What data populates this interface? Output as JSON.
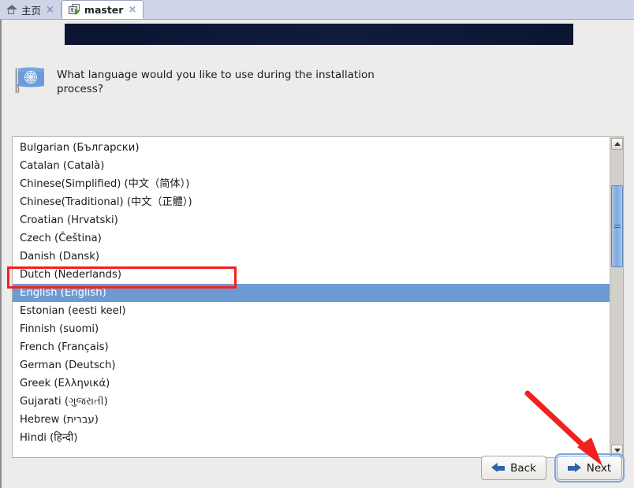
{
  "tabs": [
    {
      "label": "主页",
      "icon": "home-icon",
      "close": "×",
      "active": false
    },
    {
      "label": "master",
      "icon": "virtual-machine-icon",
      "close": "×",
      "active": true
    }
  ],
  "installer": {
    "icon": "un-flag-icon",
    "question": "What language would you like to use during the installation process?",
    "languages": [
      "Bulgarian (Български)",
      "Catalan (Català)",
      "Chinese(Simplified) (中文（简体）)",
      "Chinese(Traditional) (中文（正體）)",
      "Croatian (Hrvatski)",
      "Czech (Čeština)",
      "Danish (Dansk)",
      "Dutch (Nederlands)",
      "English (English)",
      "Estonian (eesti keel)",
      "Finnish (suomi)",
      "French (Français)",
      "German (Deutsch)",
      "Greek (Ελληνικά)",
      "Gujarati (ગુજરાતી)",
      "Hebrew (עברית)",
      "Hindi (हिन्दी)"
    ],
    "selected_language": "English (English)",
    "selected_index": 8,
    "scrollbar": {
      "up_arrow": "chevron-up-icon",
      "down_arrow": "chevron-down-icon",
      "thumb_position_percent": 15
    },
    "buttons": {
      "back_label": "Back",
      "back_icon": "arrow-left-icon",
      "next_label": "Next",
      "next_icon": "arrow-right-icon",
      "next_focused": true
    }
  },
  "annotations": {
    "highlight_target": "English (English)",
    "arrow_target": "Next",
    "color": "#f32020"
  },
  "colors": {
    "tabbar_background": "#ced5e8",
    "banner": "#0d1733",
    "page_background": "#edecea",
    "selection": "#6d9bd1",
    "scrollbar_thumb": "#7faadd",
    "button_arrow": "#2f62ab",
    "annotation_red": "#f32020"
  }
}
